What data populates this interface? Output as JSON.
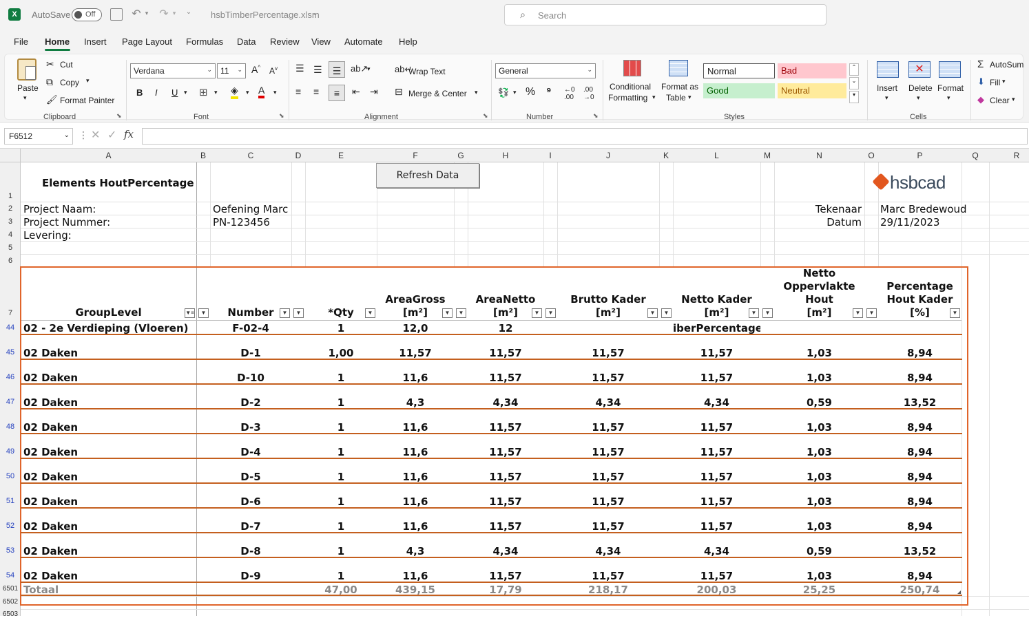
{
  "titlebar": {
    "autosave_label": "AutoSave",
    "autosave_state": "Off",
    "filename": "hsbTimberPercentage.xlsm",
    "search_placeholder": "Search"
  },
  "menu": [
    "File",
    "Home",
    "Insert",
    "Page Layout",
    "Formulas",
    "Data",
    "Review",
    "View",
    "Automate",
    "Help"
  ],
  "ribbon": {
    "clipboard": {
      "paste": "Paste",
      "cut": "Cut",
      "copy": "Copy",
      "format_painter": "Format Painter",
      "label": "Clipboard"
    },
    "font": {
      "name": "Verdana",
      "size": "11",
      "label": "Font"
    },
    "alignment": {
      "wrap_text": "Wrap Text",
      "merge_center": "Merge & Center",
      "label": "Alignment"
    },
    "number": {
      "format": "General",
      "label": "Number"
    },
    "styles": {
      "conditional_1": "Conditional",
      "conditional_2": "Formatting",
      "format_table_1": "Format as",
      "format_table_2": "Table",
      "normal": "Normal",
      "bad": "Bad",
      "good": "Good",
      "neutral": "Neutral",
      "label": "Styles"
    },
    "cells": {
      "insert": "Insert",
      "delete": "Delete",
      "format": "Format",
      "label": "Cells"
    },
    "editing": {
      "autosum": "AutoSum",
      "fill": "Fill",
      "clear": "Clear"
    }
  },
  "formula_bar": {
    "name_box": "F6512",
    "fx": "fx",
    "content": ""
  },
  "columns": [
    "A",
    "B",
    "C",
    "D",
    "E",
    "F",
    "G",
    "H",
    "I",
    "J",
    "K",
    "L",
    "M",
    "N",
    "O",
    "P",
    "Q",
    "R"
  ],
  "sheet": {
    "title": "Elements HoutPercentage",
    "refresh_button": "Refresh Data",
    "logo": "hsbcad",
    "project_naam_label": "Project Naam:",
    "project_naam": "Oefening Marc",
    "project_nummer_label": "Project Nummer:",
    "project_nummer": "PN-123456",
    "levering_label": "Levering:",
    "tekenaar_label": "Tekenaar",
    "tekenaar": "Marc Bredewoud",
    "datum_label": "Datum",
    "datum": "29/11/2023"
  },
  "top_rows": [
    "1",
    "2",
    "3",
    "4",
    "5",
    "6",
    "7"
  ],
  "table": {
    "headers": {
      "group": "GroupLevel",
      "number": "Number",
      "qty": "*Qty",
      "areagross_1": "AreaGross",
      "areagross_2": "[m²]",
      "areanetto_1": "AreaNetto",
      "areanetto_2": "[m²]",
      "brutto_1": "Brutto Kader",
      "brutto_2": "[m²]",
      "netto_1": "Netto Kader",
      "netto_2": "[m²]",
      "opp_1": "Netto",
      "opp_2": "Oppervlakte",
      "opp_3": "Hout",
      "opp_4": "[m²]",
      "pct_1": "Percentage",
      "pct_2": "Hout Kader",
      "pct_3": "[%]"
    },
    "rows": [
      {
        "row": "44",
        "group": "02 - 2e Verdieping (Vloeren)",
        "number": "F-02-4",
        "qty": "1",
        "gross": "12,0",
        "netto": "12",
        "brutto": "",
        "nettokader": "iberPercentage.",
        "opp": "",
        "pct": ""
      },
      {
        "row": "45",
        "group": "02 Daken",
        "number": "D-1",
        "qty": "1,00",
        "gross": "11,57",
        "netto": "11,57",
        "brutto": "11,57",
        "nettokader": "11,57",
        "opp": "1,03",
        "pct": "8,94"
      },
      {
        "row": "46",
        "group": "02 Daken",
        "number": "D-10",
        "qty": "1",
        "gross": "11,6",
        "netto": "11,57",
        "brutto": "11,57",
        "nettokader": "11,57",
        "opp": "1,03",
        "pct": "8,94"
      },
      {
        "row": "47",
        "group": "02 Daken",
        "number": "D-2",
        "qty": "1",
        "gross": "4,3",
        "netto": "4,34",
        "brutto": "4,34",
        "nettokader": "4,34",
        "opp": "0,59",
        "pct": "13,52"
      },
      {
        "row": "48",
        "group": "02 Daken",
        "number": "D-3",
        "qty": "1",
        "gross": "11,6",
        "netto": "11,57",
        "brutto": "11,57",
        "nettokader": "11,57",
        "opp": "1,03",
        "pct": "8,94"
      },
      {
        "row": "49",
        "group": "02 Daken",
        "number": "D-4",
        "qty": "1",
        "gross": "11,6",
        "netto": "11,57",
        "brutto": "11,57",
        "nettokader": "11,57",
        "opp": "1,03",
        "pct": "8,94"
      },
      {
        "row": "50",
        "group": "02 Daken",
        "number": "D-5",
        "qty": "1",
        "gross": "11,6",
        "netto": "11,57",
        "brutto": "11,57",
        "nettokader": "11,57",
        "opp": "1,03",
        "pct": "8,94"
      },
      {
        "row": "51",
        "group": "02 Daken",
        "number": "D-6",
        "qty": "1",
        "gross": "11,6",
        "netto": "11,57",
        "brutto": "11,57",
        "nettokader": "11,57",
        "opp": "1,03",
        "pct": "8,94"
      },
      {
        "row": "52",
        "group": "02 Daken",
        "number": "D-7",
        "qty": "1",
        "gross": "11,6",
        "netto": "11,57",
        "brutto": "11,57",
        "nettokader": "11,57",
        "opp": "1,03",
        "pct": "8,94"
      },
      {
        "row": "53",
        "group": "02 Daken",
        "number": "D-8",
        "qty": "1",
        "gross": "4,3",
        "netto": "4,34",
        "brutto": "4,34",
        "nettokader": "4,34",
        "opp": "0,59",
        "pct": "13,52"
      },
      {
        "row": "54",
        "group": "02 Daken",
        "number": "D-9",
        "qty": "1",
        "gross": "11,6",
        "netto": "11,57",
        "brutto": "11,57",
        "nettokader": "11,57",
        "opp": "1,03",
        "pct": "8,94"
      }
    ],
    "total": {
      "row": "6501",
      "label": "Totaal",
      "qty": "47,00",
      "gross": "439,15",
      "netto": "17,79",
      "brutto": "218,17",
      "nettokader": "200,03",
      "opp": "25,25",
      "pct": "250,74"
    },
    "extra_rows": [
      "6502",
      "6503"
    ]
  },
  "colors": {
    "accent": "#107c41",
    "table_border": "#e0642a",
    "row_line": "#c45f1e"
  }
}
